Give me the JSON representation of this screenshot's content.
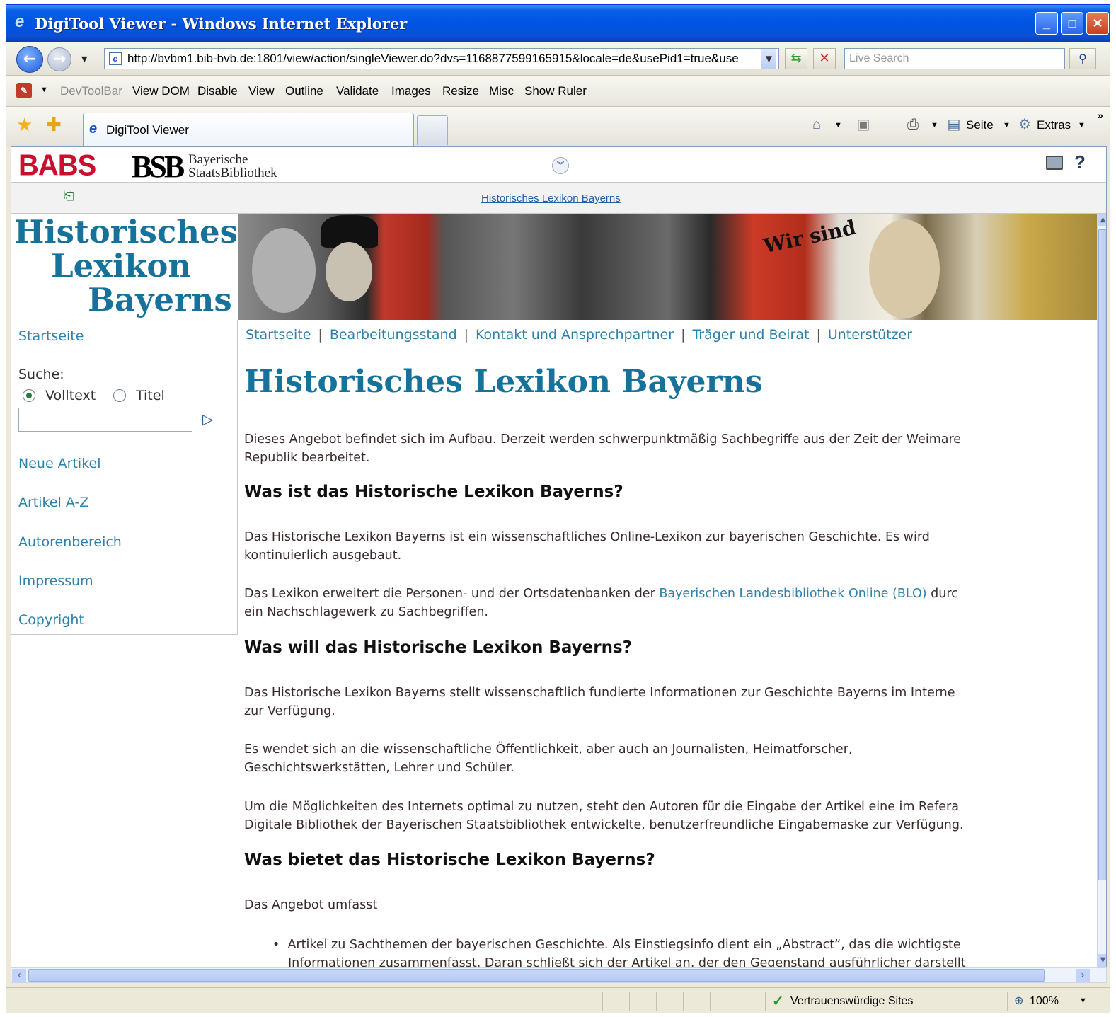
{
  "window": {
    "title": "DigiTool Viewer - Windows Internet Explorer",
    "min_glyph": "_",
    "max_glyph": "□",
    "close_glyph": "✕"
  },
  "address": {
    "url": "http://bvbm1.bib-bvb.de:1801/view/action/singleViewer.do?dvs=1168877599165915&locale=de&usePid1=true&use",
    "search_placeholder": "Live Search"
  },
  "devtoolbar": {
    "label": "DevToolBar",
    "items": [
      "View DOM",
      "Disable",
      "View",
      "Outline",
      "Validate",
      "Images",
      "Resize",
      "Misc",
      "Show Ruler"
    ]
  },
  "tabs": {
    "active_label": "DigiTool Viewer"
  },
  "commands": {
    "page_label": "Seite",
    "extras_label": "Extras"
  },
  "digitool": {
    "babs_logo": "BABS",
    "bsb_logo": "BSB",
    "bsb_line1": "Bayerische",
    "bsb_line2": "StaatsBibliothek",
    "link": "Historisches Lexikon Bayerns"
  },
  "lexikon": {
    "logo_line1": "Historisches",
    "logo_line2": "Lexikon",
    "logo_line3": "Bayerns",
    "sidebar": {
      "startseite": "Startseite",
      "suche_label": "Suche:",
      "radio_volltext": "Volltext",
      "radio_titel": "Titel",
      "neue_artikel": "Neue Artikel",
      "artikel_az": "Artikel A-Z",
      "autorenbereich": "Autorenbereich",
      "impressum": "Impressum",
      "copyright": "Copyright"
    },
    "topnav": [
      "Startseite",
      "Bearbeitungsstand",
      "Kontakt und Ansprechpartner",
      "Träger und Beirat",
      "Unterstützer"
    ],
    "topnav_separator": "|",
    "title": "Historisches Lexikon Bayerns",
    "intro_line1": "Dieses Angebot befindet sich im Aufbau. Derzeit werden schwerpunktmäßig Sachbegriffe aus der Zeit der Weimare",
    "intro_line2": "Republik bearbeitet.",
    "h2_was_ist": "Was ist das Historische Lexikon Bayerns?",
    "p1_line1": "Das Historische Lexikon Bayerns ist ein wissenschaftliches Online-Lexikon zur bayerischen Geschichte. Es wird",
    "p1_line2": "kontinuierlich ausgebaut.",
    "p2_line1_a": "Das Lexikon erweitert die Personen- und der Ortsdatenbanken der ",
    "p2_link": "Bayerischen Landesbibliothek Online (BLO)",
    "p2_line1_b": " durc",
    "p2_line2": "ein Nachschlagewerk zu Sachbegriffen.",
    "h2_was_will": "Was will das Historische Lexikon Bayerns?",
    "p3_line1": "Das Historische Lexikon Bayerns stellt wissenschaftlich fundierte Informationen zur Geschichte Bayerns im Interne",
    "p3_line2": "zur Verfügung.",
    "p4_line1": "Es wendet sich an die wissenschaftliche Öffentlichkeit, aber auch an Journalisten, Heimatforscher,",
    "p4_line2": "Geschichtswerkstätten, Lehrer und Schüler.",
    "p5_line1": "Um die Möglichkeiten des Internets optimal zu nutzen, steht den Autoren für die Eingabe der Artikel eine im Refera",
    "p5_line2": "Digitale Bibliothek der Bayerischen Staatsbibliothek entwickelte, benutzerfreundliche Eingabemaske zur Verfügung.",
    "h2_was_bietet": "Was bietet das Historische Lexikon Bayerns?",
    "p6": "Das Angebot umfasst",
    "bullet_glyph": "•",
    "bullet_line1": "Artikel zu Sachthemen der bayerischen Geschichte. Als Einstiegsinfo dient ein „Abstract“, das die wichtigste",
    "bullet_line2": "Informationen zusammenfasst. Daran schließt sich der Artikel an, der den Gegenstand ausführlicher darstellt"
  },
  "status": {
    "zone": "Vertrauenswürdige Sites",
    "zoom": "100%"
  }
}
